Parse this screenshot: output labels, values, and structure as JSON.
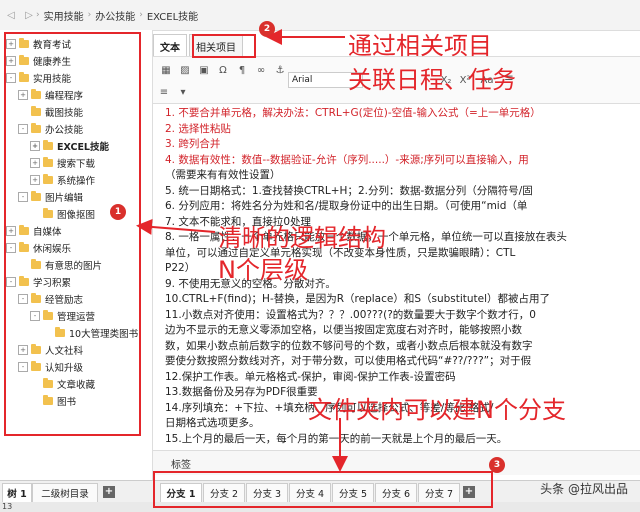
{
  "breadcrumb": [
    "实用技能",
    "办公技能",
    "EXCEL技能"
  ],
  "tree": [
    {
      "label": "教育考试",
      "level": 0,
      "expander": "+"
    },
    {
      "label": "健康养生",
      "level": 0,
      "expander": "+"
    },
    {
      "label": "实用技能",
      "level": 0,
      "expander": "-"
    },
    {
      "label": "编程程序",
      "level": 1,
      "expander": "+"
    },
    {
      "label": "截图技能",
      "level": 1,
      "expander": ""
    },
    {
      "label": "办公技能",
      "level": 1,
      "expander": "-"
    },
    {
      "label": "EXCEL技能",
      "level": 2,
      "expander": "+",
      "selected": true
    },
    {
      "label": "搜索下载",
      "level": 2,
      "expander": "+"
    },
    {
      "label": "系统操作",
      "level": 2,
      "expander": "+"
    },
    {
      "label": "图片编辑",
      "level": 1,
      "expander": "-"
    },
    {
      "label": "图像抠图",
      "level": 2,
      "expander": ""
    },
    {
      "label": "自媒体",
      "level": 0,
      "expander": "+"
    },
    {
      "label": "休闲娱乐",
      "level": 0,
      "expander": "-"
    },
    {
      "label": "有意思的图片",
      "level": 1,
      "expander": ""
    },
    {
      "label": "学习积累",
      "level": 0,
      "expander": "-"
    },
    {
      "label": "经管励志",
      "level": 1,
      "expander": "-"
    },
    {
      "label": "管理运营",
      "level": 2,
      "expander": "-"
    },
    {
      "label": "10大管理类图书",
      "level": 3,
      "expander": ""
    },
    {
      "label": "人文社科",
      "level": 1,
      "expander": "+"
    },
    {
      "label": "认知升级",
      "level": 1,
      "expander": "-"
    },
    {
      "label": "文章收藏",
      "level": 2,
      "expander": ""
    },
    {
      "label": "图书",
      "level": 2,
      "expander": ""
    }
  ],
  "editor_tabs": {
    "text": "文本",
    "related": "相关项目"
  },
  "toolbar": {
    "font": "Arial",
    "sub": "X₂",
    "sup": "X²",
    "aa": "Aa"
  },
  "content_lines": [
    {
      "text": "1. 不要合并单元格，解决办法：CTRL+G(定位)-空值-输入公式（=上一单元格）",
      "color": "red"
    },
    {
      "text": "2. 选择性粘贴",
      "color": "red"
    },
    {
      "text": "3. 跨列合并",
      "color": "red"
    },
    {
      "text": "4. 数据有效性：数值--数据验证-允许（序列.....）-来源;序列可以直接输入，用",
      "color": "red"
    },
    {
      "text": "    （需要来有有效性设置）",
      "color": "black"
    },
    {
      "text": "5. 统一日期格式：1.查找替换CTRL+H；2.分列：数据-数据分列（分隔符号/固",
      "color": "black"
    },
    {
      "text": "6. 分列应用：将姓名分为姓和名/提取身份证中的出生日期。（可使用“mid（单",
      "color": "black"
    },
    {
      "text": "7. 文本不能求和，直接拉0处理",
      "color": "black"
    },
    {
      "text": "8. 一格一属性：一个单元格只能放一个数据，一个单元格，单位统一可以直接放在表头",
      "color": "black"
    },
    {
      "text": "    单位，可以通过自定义单元格实现（不改变本身性质，只是欺骗眼睛）：CTL",
      "color": "black"
    },
    {
      "text": "    P22）",
      "color": "black"
    },
    {
      "text": "9. 不使用无意义的空格。分散对齐。",
      "color": "black"
    },
    {
      "text": "10.CTRL+F(find)；H-替换，是因为R（replace）和S（substitutel）都被占用了",
      "color": "black"
    },
    {
      "text": "11.小数点对齐使用：设置格式为？？？.00???(?的数量要大于数字个数才行，0",
      "color": "black"
    },
    {
      "text": "    边为不显示的无意义零添加空格，以便当按固定宽度右对齐时，能够按照小数",
      "color": "black"
    },
    {
      "text": "    数，如果小数点前后数字的位数不够问号的个数，或者小数点后根本就没有数字",
      "color": "black"
    },
    {
      "text": "    要使分数按照分数线对齐，对于带分数，可以使用格式代码“#??/???”；对于假",
      "color": "black"
    },
    {
      "text": "12.保护工作表。单元格格式-保护，审阅-保护工作表-设置密码",
      "color": "black"
    },
    {
      "text": "13.数据备份及另存为PDF很重要",
      "color": "black"
    },
    {
      "text": "14.序列填充：+下拉、+填充柄、序列可以选择公式、等差/等比/格式/",
      "color": "black"
    },
    {
      "text": "    日期格式选项更多。",
      "color": "black"
    },
    {
      "text": "15.上个月的最后一天，每个月的第一天的前一天就是上个月的最后一天。",
      "color": "black"
    }
  ],
  "tags_label": "标签",
  "bottom_tabs_left": [
    "树 1",
    "二级树目录"
  ],
  "branch_tabs": [
    "分支 1",
    "分支 2",
    "分支 3",
    "分支 4",
    "分支 5",
    "分支 6",
    "分支 7"
  ],
  "status_text": "13",
  "annotations": {
    "marker1": "1",
    "marker2": "2",
    "marker3": "3",
    "text1_line1": "清晰的逻辑结构",
    "text1_line2": "N个层级",
    "text2_line1": "通过相关项目",
    "text2_line2": "关联日程、任务",
    "text3": "文件夹内可以建N个分支"
  },
  "watermark": "头条 @拉风出品"
}
